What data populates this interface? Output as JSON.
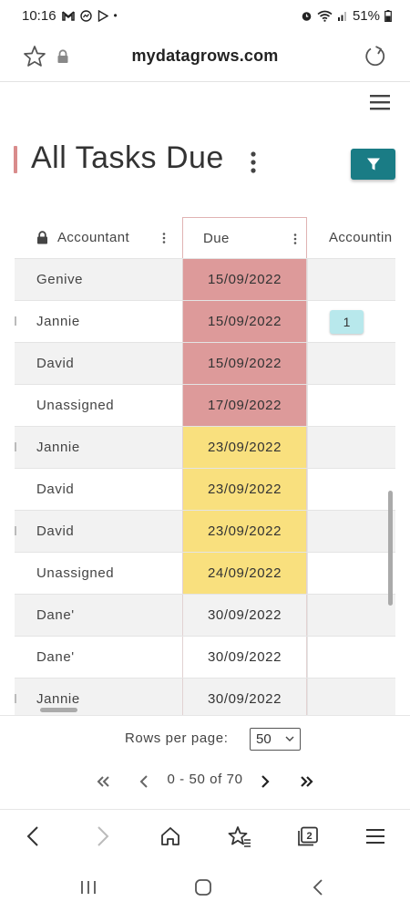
{
  "status_bar": {
    "time": "10:16",
    "app_icons": [
      "gmail-icon",
      "messenger-icon",
      "play-icon"
    ],
    "dot": "•",
    "battery": "51%"
  },
  "browser": {
    "url": "mydatagrows.com"
  },
  "page": {
    "title": "All Tasks Due",
    "filter_icon": "filter-icon"
  },
  "table": {
    "columns": {
      "accountant": "Accountant",
      "due": "Due",
      "accounting": "Accountin"
    },
    "rows": [
      {
        "accountant": "Genive",
        "due": "15/09/2022",
        "status": "overdue",
        "accounting": ""
      },
      {
        "accountant": "Jannie",
        "due": "15/09/2022",
        "status": "overdue",
        "accounting": "1"
      },
      {
        "accountant": "David",
        "due": "15/09/2022",
        "status": "overdue",
        "accounting": ""
      },
      {
        "accountant": "Unassigned",
        "due": "17/09/2022",
        "status": "overdue",
        "accounting": ""
      },
      {
        "accountant": "Jannie",
        "due": "23/09/2022",
        "status": "due-soon",
        "accounting": ""
      },
      {
        "accountant": "David",
        "due": "23/09/2022",
        "status": "due-soon",
        "accounting": ""
      },
      {
        "accountant": "David",
        "due": "23/09/2022",
        "status": "due-soon",
        "accounting": ""
      },
      {
        "accountant": "Unassigned",
        "due": "24/09/2022",
        "status": "due-soon",
        "accounting": ""
      },
      {
        "accountant": "Dane'",
        "due": "30/09/2022",
        "status": "normal",
        "accounting": ""
      },
      {
        "accountant": "Dane'",
        "due": "30/09/2022",
        "status": "normal",
        "accounting": ""
      },
      {
        "accountant": "Jannie",
        "due": "30/09/2022",
        "status": "normal",
        "accounting": ""
      }
    ]
  },
  "pagination": {
    "rows_per_page_label": "Rows per page:",
    "rows_per_page_value": "50",
    "range": "0 - 50 of 70"
  },
  "colors": {
    "accent": "#1a7c85",
    "overdue": "#dd9a9a",
    "due_soon": "#f9e07e",
    "badge": "#b8e8ec"
  },
  "bottom_bar": {
    "tab_count": "2"
  }
}
